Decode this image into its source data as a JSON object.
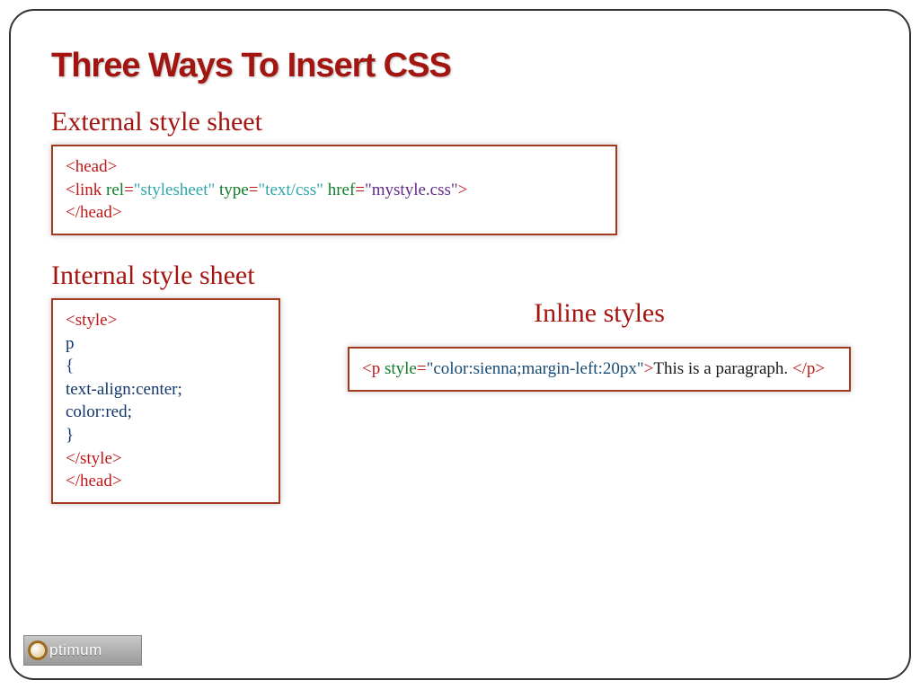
{
  "title": "Three Ways To Insert CSS",
  "external": {
    "heading": "External style sheet",
    "line1_open": "<head>",
    "line2_tag_open": "<link ",
    "line2_attr_rel": "rel",
    "line2_eq1": "=",
    "line2_val_rel": "\"stylesheet\"",
    "line2_space1": " ",
    "line2_attr_type": "type",
    "line2_eq2": "=",
    "line2_val_type": "\"text/css\"",
    "line2_space2": " ",
    "line2_attr_href": "href",
    "line2_eq3": "=",
    "line2_val_href": "\"mystyle.css\"",
    "line2_tag_close": ">",
    "line3_close": "</head>"
  },
  "internal": {
    "heading": "Internal style sheet",
    "l1": "<style>",
    "l2": "p",
    "l3": "{",
    "l4": "text-align:center;",
    "l5": "color:red;",
    "l6": "}",
    "l7": "</style>",
    "l8": "</head>"
  },
  "inline": {
    "heading": "Inline styles",
    "tag_open": "<p ",
    "attr": "style",
    "eq": "=",
    "val": "\"color:sienna;margin-left:20px\"",
    "tag_close": ">",
    "text": "This is a paragraph. ",
    "end": "</p>"
  },
  "logo": {
    "text": "ptimum"
  }
}
